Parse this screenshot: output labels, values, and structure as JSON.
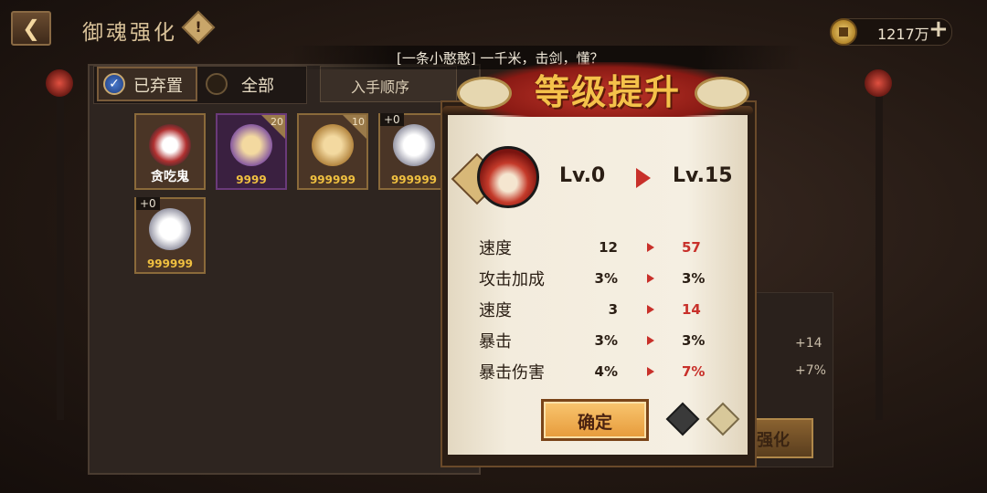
{
  "header": {
    "title": "御魂强化",
    "back_icon": "chevron-left-icon",
    "info_icon": "exclamation-icon",
    "currency_value": "1217万",
    "currency_add": "+"
  },
  "chat": {
    "message": "[一条小憨憨] 一千米，击剑，懂？"
  },
  "left_panel": {
    "tab_abandoned": "已弃置",
    "tab_all": "全部",
    "sort_label": "入手顺序",
    "cards": [
      {
        "name": "贪吃鬼",
        "num": "",
        "plus": "",
        "corner": ""
      },
      {
        "name": "",
        "num": "9999",
        "plus": "",
        "corner": "20"
      },
      {
        "name": "",
        "num": "999999",
        "plus": "",
        "corner": "10"
      },
      {
        "name": "",
        "num": "999999",
        "plus": "+0",
        "corner": ""
      },
      {
        "name": "",
        "num": "999999",
        "plus": "+0",
        "corner": ""
      }
    ]
  },
  "background_panel": {
    "bonus_1": "+14",
    "bonus_2": "+7%",
    "enhance_label": "强化"
  },
  "popup": {
    "title": "等级提升",
    "level_from": "Lv.0",
    "level_to": "Lv.15",
    "stats": [
      {
        "label": "速度",
        "old": "12",
        "new": "57",
        "changed": true
      },
      {
        "label": "攻击加成",
        "old": "3%",
        "new": "3%",
        "changed": false
      },
      {
        "label": "速度",
        "old": "3",
        "new": "14",
        "changed": true
      },
      {
        "label": "暴击",
        "old": "3%",
        "new": "3%",
        "changed": false
      },
      {
        "label": "暴击伤害",
        "old": "4%",
        "new": "7%",
        "changed": true
      }
    ],
    "confirm_label": "确定",
    "colors": {
      "up": "#c8302a",
      "same": "#2a1e14"
    }
  }
}
